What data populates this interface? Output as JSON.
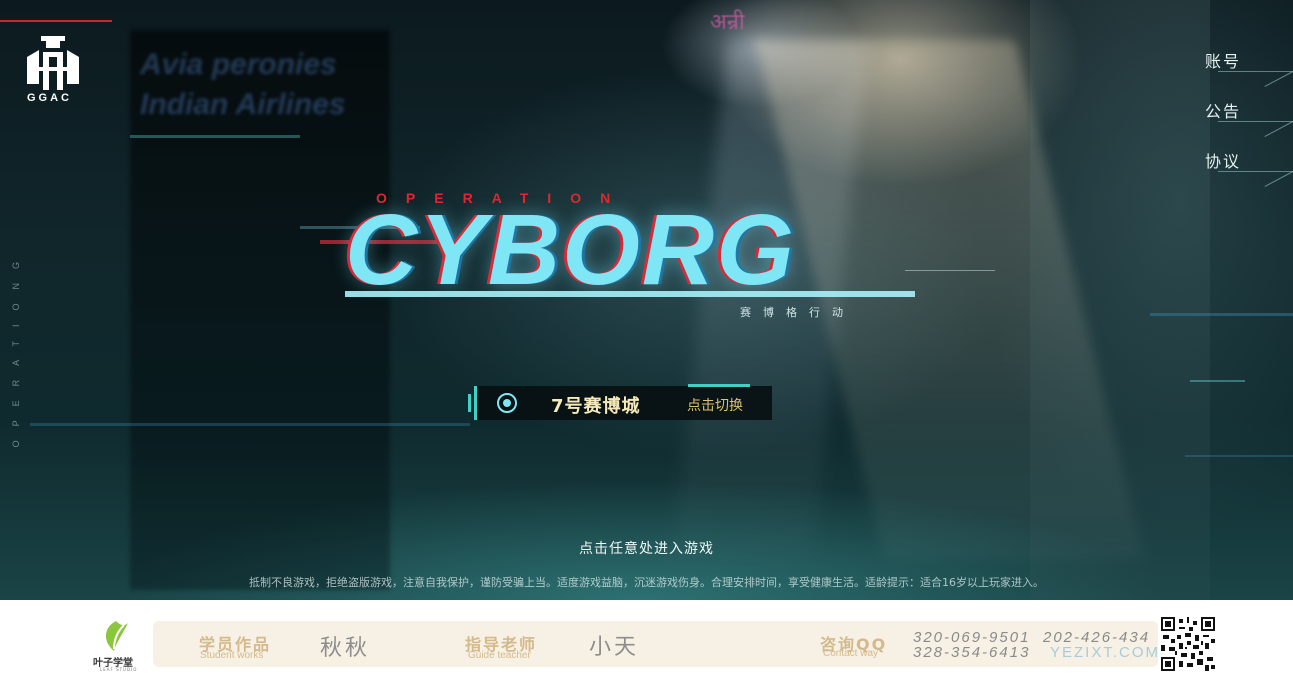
{
  "brand": {
    "logo_text": "GGAC"
  },
  "nav": {
    "items": [
      {
        "label": "账号"
      },
      {
        "label": "公告"
      },
      {
        "label": "协议"
      }
    ]
  },
  "side": {
    "vertical_text": "OPERATIONG"
  },
  "background": {
    "sign_text_1": "Avia peronies",
    "sign_text_2": "Indian Airlines",
    "hindi_sign": "अन्री"
  },
  "title": {
    "operation": "OPERATION",
    "cyborg": "CYBORG",
    "subtitle": "赛博格行动"
  },
  "server": {
    "name": "7号赛博城",
    "switch_label": "点击切换"
  },
  "prompts": {
    "enter": "点击任意处进入游戏",
    "health": "抵制不良游戏，拒绝盗版游戏，注意自我保护，谨防受骗上当。适度游戏益脑，沉迷游戏伤身。合理安排时间，享受健康生活。适龄提示：适合16岁以上玩家进入。"
  },
  "footer": {
    "studio_name": "叶子学堂",
    "studio_sub": "LEAF STUDIO",
    "student_label": "学员作品",
    "student_sub": "Student works",
    "student_name": "秋秋",
    "teacher_label": "指导老师",
    "teacher_sub": "Guide teacher",
    "teacher_name": "小天",
    "contact_label": "咨询QQ",
    "contact_sub": "Contact way",
    "qq_1": "320-069-9501",
    "qq_2": "202-426-434",
    "qq_3": "328-354-6413",
    "website": "YEZIXT.COM"
  },
  "colors": {
    "accent_cyan": "#7fe6f5",
    "accent_red": "#e0262c",
    "gold": "#d4b98c"
  },
  "icons": {
    "leaf": "leaf-icon",
    "qr": "qr-code-icon",
    "radio": "radio-icon"
  }
}
